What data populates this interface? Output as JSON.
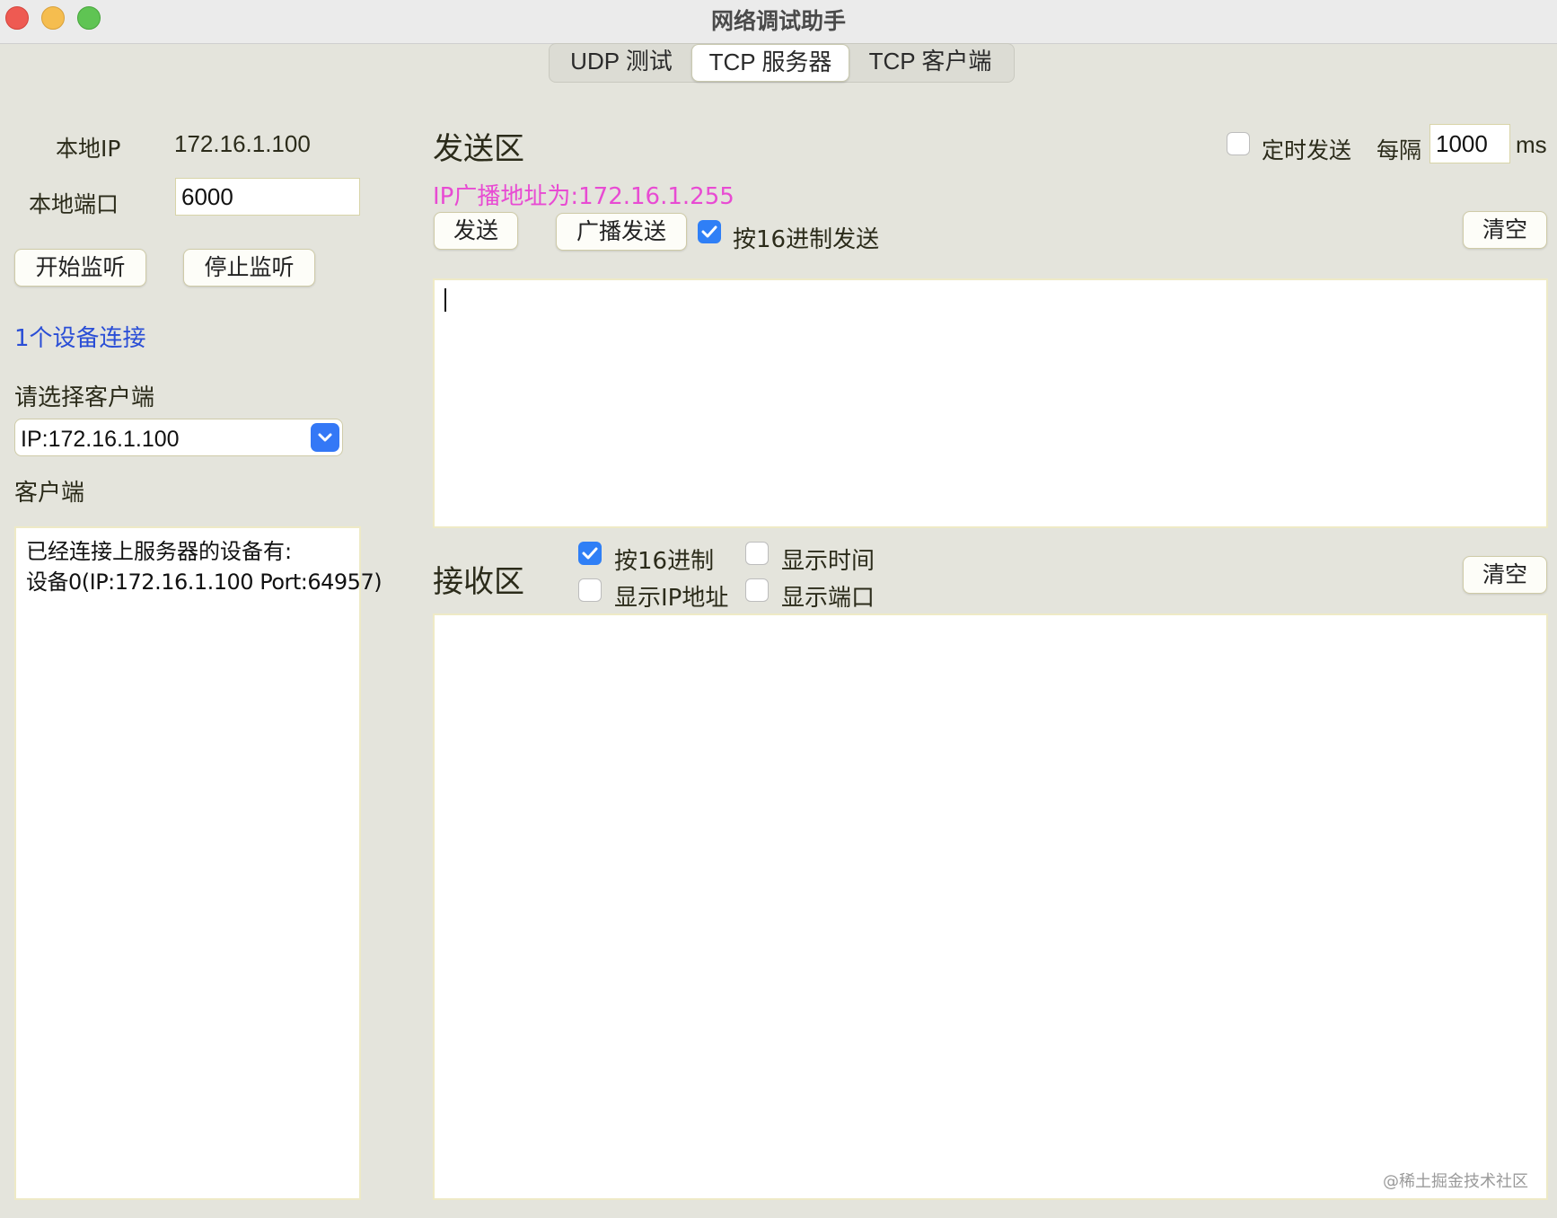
{
  "window": {
    "title": "网络调试助手"
  },
  "tabs": [
    {
      "label": "UDP 测试",
      "active": false
    },
    {
      "label": "TCP 服务器",
      "active": true
    },
    {
      "label": "TCP 客户端",
      "active": false
    }
  ],
  "left": {
    "local_ip_label": "本地IP",
    "local_ip_value": "172.16.1.100",
    "local_port_label": "本地端口",
    "local_port_value": "6000",
    "start_listen_label": "开始监听",
    "stop_listen_label": "停止监听",
    "device_count_text": "1个设备连接",
    "select_client_label": "请选择客户端",
    "client_select_value": "IP:172.16.1.100",
    "client_section_label": "客户端",
    "client_list_lines": [
      "已经连接上服务器的设备有:",
      "设备0(IP:172.16.1.100 Port:64957)"
    ]
  },
  "send": {
    "title": "发送区",
    "timed_send_label": "定时发送",
    "timed_send_checked": false,
    "interval_label": "每隔",
    "interval_value": "1000",
    "interval_unit": "ms",
    "broadcast_info": "IP广播地址为:172.16.1.255",
    "send_label": "发送",
    "broadcast_send_label": "广播发送",
    "hex_send_label": "按16进制发送",
    "hex_send_checked": true,
    "clear_label": "清空",
    "text": ""
  },
  "receive": {
    "title": "接收区",
    "hex_label": "按16进制",
    "hex_checked": true,
    "show_time_label": "显示时间",
    "show_time_checked": false,
    "show_ip_label": "显示IP地址",
    "show_ip_checked": false,
    "show_port_label": "显示端口",
    "show_port_checked": false,
    "clear_label": "清空",
    "text": ""
  },
  "watermark": "@稀土掘金技术社区",
  "colors": {
    "background": "#e4e4dc",
    "accent_blue": "#2f7ff6",
    "broadcast_text": "#e84bd3",
    "device_count_text": "#2a4ed6"
  }
}
